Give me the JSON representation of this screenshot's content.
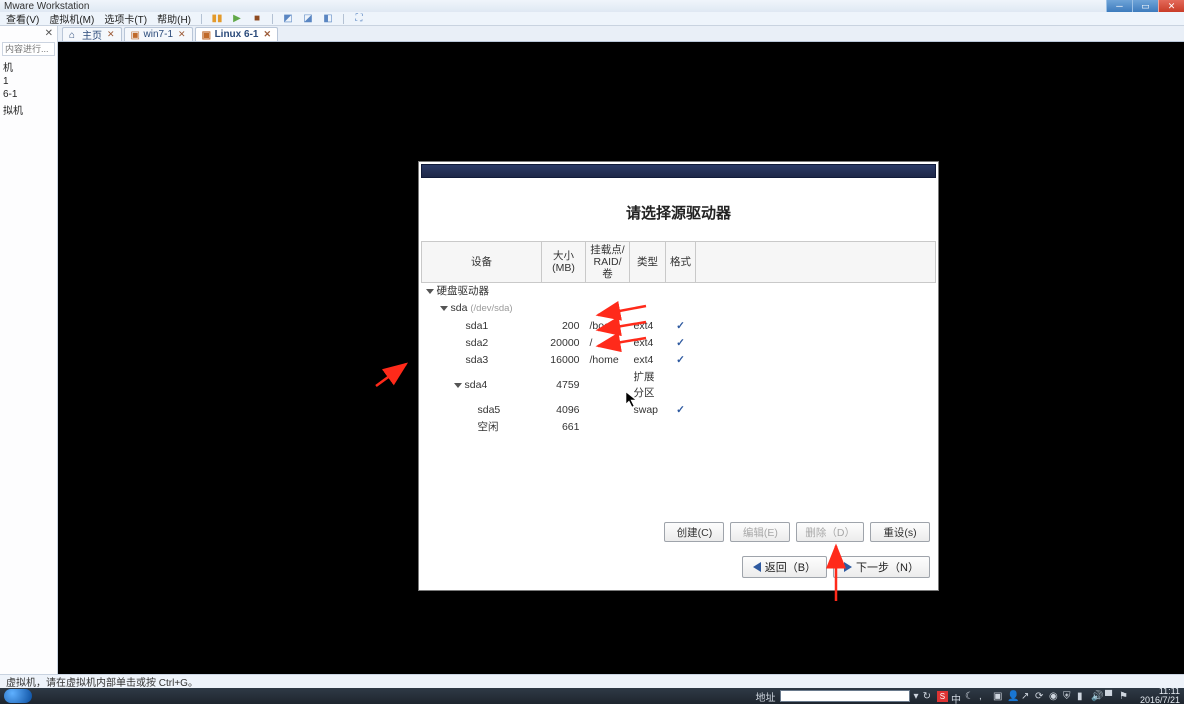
{
  "window": {
    "title": "Mware Workstation"
  },
  "menu": {
    "items": [
      "查看(V)",
      "虚拟机(M)",
      "选项卡(T)",
      "帮助(H)"
    ],
    "toolbar_icons": [
      "pause-icon",
      "play-icon",
      "stop-icon",
      "box1-icon",
      "box2-icon",
      "box3-icon",
      "fullscreen-icon"
    ]
  },
  "sidebar": {
    "placeholder": "内容进行...",
    "items": [
      "机",
      "1",
      "6-1",
      "拟机"
    ]
  },
  "tabs": [
    {
      "label": "主页",
      "icon": "home-icon",
      "active": false
    },
    {
      "label": "win7-1",
      "icon": "vm-icon",
      "active": false
    },
    {
      "label": "Linux 6-1",
      "icon": "vm-icon",
      "active": true
    }
  ],
  "installer": {
    "title": "请选择源驱动器",
    "columns": {
      "device": "设备",
      "size": "大小\n(MB)",
      "mount": "挂载点/\nRAID/卷",
      "type": "类型",
      "format": "格式"
    },
    "tree": {
      "root": "硬盘驱动器",
      "disk_label": "sda",
      "disk_hint": "(/dev/sda)",
      "rows": [
        {
          "dev": "sda1",
          "size": "200",
          "mount": "/boot",
          "type": "ext4",
          "fmt": true
        },
        {
          "dev": "sda2",
          "size": "20000",
          "mount": "/",
          "type": "ext4",
          "fmt": true
        },
        {
          "dev": "sda3",
          "size": "16000",
          "mount": "/home",
          "type": "ext4",
          "fmt": true
        },
        {
          "dev": "sda4",
          "size": "4759",
          "mount": "",
          "type": "扩展分区",
          "fmt": false,
          "group": true
        },
        {
          "dev": "sda5",
          "size": "4096",
          "mount": "",
          "type": "swap",
          "fmt": true,
          "indent": true
        },
        {
          "dev": "空闲",
          "size": "661",
          "mount": "",
          "type": "",
          "fmt": false,
          "indent": true
        }
      ]
    },
    "buttons": {
      "create": "创建(C)",
      "edit": "编辑(E)",
      "delete": "删除（D）",
      "reset": "重设(s)",
      "back": "返回（B）",
      "next": "下一步（N）"
    }
  },
  "statusbar": {
    "hint": "虚拟机，请在虚拟机内部单击或按 Ctrl+G。"
  },
  "taskbar": {
    "addr_label": "地址",
    "tray_icons": [
      "s-icon",
      "ime-icon",
      "moon-icon",
      "lang-icon",
      "monitor-icon",
      "user-icon",
      "link-icon",
      "refresh-icon",
      "globe-icon",
      "shield-icon",
      "battery-icon",
      "volume-icon",
      "network-icon",
      "flag-icon"
    ],
    "time": "11:11",
    "date": "2016/7/21"
  }
}
